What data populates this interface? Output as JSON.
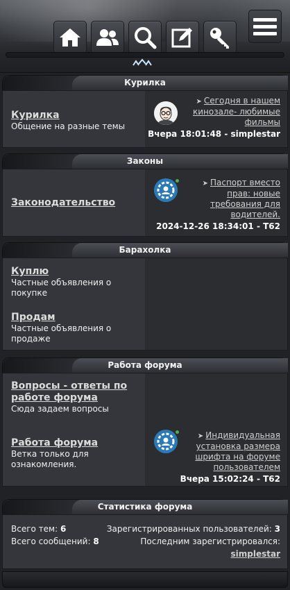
{
  "header": {
    "nav_icons": [
      "home-icon",
      "users-icon",
      "search-icon",
      "edit-icon",
      "key-icon"
    ],
    "menu_icon": "hamburger-menu-icon",
    "collapse_label": "^^^"
  },
  "sections": [
    {
      "title": "Курилка",
      "forums": [
        {
          "name": "Курилка",
          "desc": "Общение на разные темы"
        }
      ],
      "last_post": {
        "topic": "Сегодня в нашем кинозале- любимые фильмы",
        "time": "Вчера 18:01:48",
        "author": "simplestar"
      }
    },
    {
      "title": "Законы",
      "forums": [
        {
          "name": "Законодательство",
          "desc": ""
        }
      ],
      "last_post": {
        "topic": "Паспорт вместо прав: новые требования для водителей.",
        "time": "2024-12-26 18:34:01",
        "author": "T62"
      }
    },
    {
      "title": "Барахолка",
      "forums": [
        {
          "name": "Куплю",
          "desc": "Частные объявления о покупке"
        },
        {
          "name": "Продам",
          "desc": "Частные объявления о продаже"
        }
      ]
    },
    {
      "title": "Работа форума",
      "forums": [
        {
          "name": "Вопросы - ответы по работе форума",
          "desc": "Сюда задаем вопросы"
        },
        {
          "name": "Работа форума",
          "desc": "Ветка только для ознакомления."
        }
      ],
      "last_post": {
        "topic": "Индивидуальная установка размера шрифта на форуме пользователем",
        "time": "Вчера 15:02:24",
        "author": "T62"
      }
    }
  ],
  "stats": {
    "title": "Статистика форума",
    "topics_label": "Всего тем:",
    "topics_value": "6",
    "posts_label": "Всего сообщений:",
    "posts_value": "8",
    "users_label": "Зарегистрированных пользователей:",
    "users_value": "3",
    "last_registered_label": "Последним зарегистрировался:",
    "last_registered_user": "simplestar"
  },
  "separator": " - "
}
